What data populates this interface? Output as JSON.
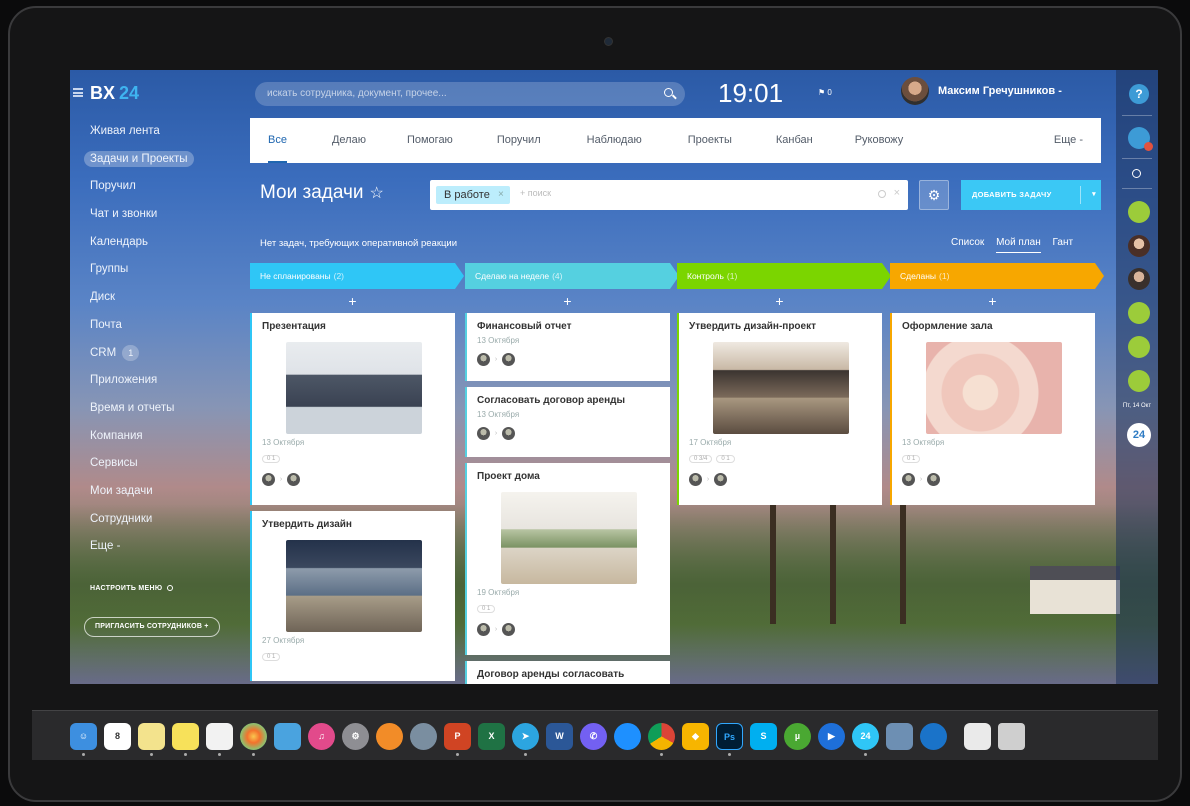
{
  "app": {
    "logo_text": "BX",
    "logo_num": "24"
  },
  "sidebar": {
    "items": [
      {
        "label": "Живая лента"
      },
      {
        "label": "Задачи и Проекты"
      },
      {
        "label": "Поручил"
      },
      {
        "label": "Чат и звонки"
      },
      {
        "label": "Календарь"
      },
      {
        "label": "Группы"
      },
      {
        "label": "Диск"
      },
      {
        "label": "Почта"
      },
      {
        "label": "CRM",
        "count": "1"
      },
      {
        "label": "Приложения"
      },
      {
        "label": "Время и отчеты"
      },
      {
        "label": "Компания"
      },
      {
        "label": "Сервисы"
      },
      {
        "label": "Мои задачи"
      },
      {
        "label": "Сотрудники"
      },
      {
        "label": "Еще -"
      }
    ],
    "configure_menu": "НАСТРОИТЬ МЕНЮ",
    "invite": "ПРИГЛАСИТЬ СОТРУДНИКОВ +"
  },
  "header": {
    "search_placeholder": "искать сотрудника, документ, прочее...",
    "time": "19:01",
    "flag_count": "0",
    "user_name": "Максим Гречушников -"
  },
  "tabs": [
    {
      "label": "Все"
    },
    {
      "label": "Делаю"
    },
    {
      "label": "Помогаю"
    },
    {
      "label": "Поручил"
    },
    {
      "label": "Наблюдаю"
    },
    {
      "label": "Проекты"
    },
    {
      "label": "Канбан"
    },
    {
      "label": "Руковожу"
    }
  ],
  "tab_more": "Еще -",
  "page": {
    "title": "Мои задачи",
    "star": "☆",
    "filter_chip": "В работе",
    "filter_placeholder": "+ поиск",
    "add_button": "ДОБАВИТЬ ЗАДАЧУ",
    "hint": "Нет задач, требующих оперативной реакции",
    "views": {
      "list": "Список",
      "plan": "Мой план",
      "gantt": "Гант"
    }
  },
  "columns": [
    {
      "title": "Не спланированы",
      "count": "(2)",
      "color": "#2fc6f6",
      "cards": [
        {
          "title": "Презентация",
          "date": "13 Октября",
          "pill": "0 1"
        },
        {
          "title": "Утвердить дизайн",
          "date": "27 Октября",
          "pill": "0 1"
        }
      ]
    },
    {
      "title": "Сделаю на неделе",
      "count": "(4)",
      "color": "#55d0e0",
      "cards": [
        {
          "title": "Финансовый отчет",
          "date": "13 Октября"
        },
        {
          "title": "Согласовать договор аренды",
          "date": "13 Октября"
        },
        {
          "title": "Проект дома",
          "date": "19 Октября",
          "pill": "0 1"
        },
        {
          "title": "Договор аренды согласовать"
        }
      ]
    },
    {
      "title": "Контроль",
      "count": "(1)",
      "color": "#7bd500",
      "cards": [
        {
          "title": "Утвердить дизайн-проект",
          "date": "17 Октября",
          "pill": "0 3/4",
          "pill2": "0 1"
        }
      ]
    },
    {
      "title": "Сделаны",
      "count": "(1)",
      "color": "#f7a700",
      "cards": [
        {
          "title": "Оформление зала",
          "date": "13 Октября",
          "pill": "0 1"
        }
      ]
    }
  ],
  "right_panel": {
    "help": "?",
    "date_label": "Пт, 14 Окт",
    "logo": "24"
  },
  "dock": {
    "apps": [
      "finder",
      "calendar",
      "notes",
      "stickies",
      "reminders",
      "photos",
      "preview",
      "itunes",
      "system-preferences",
      "ibooks",
      "launchpad",
      "powerpoint",
      "excel",
      "telegram",
      "word",
      "viber",
      "safari",
      "chrome",
      "sketch",
      "photoshop",
      "skype",
      "utorrent",
      "quicktime",
      "bitrix24",
      "preview-photos",
      "network",
      "finder-window",
      "trash"
    ],
    "calendar_day": "8",
    "ps_label": "Ps",
    "s_label": "S",
    "p_label": "P",
    "x_label": "X",
    "w_label": "W",
    "b24_label": "24"
  }
}
